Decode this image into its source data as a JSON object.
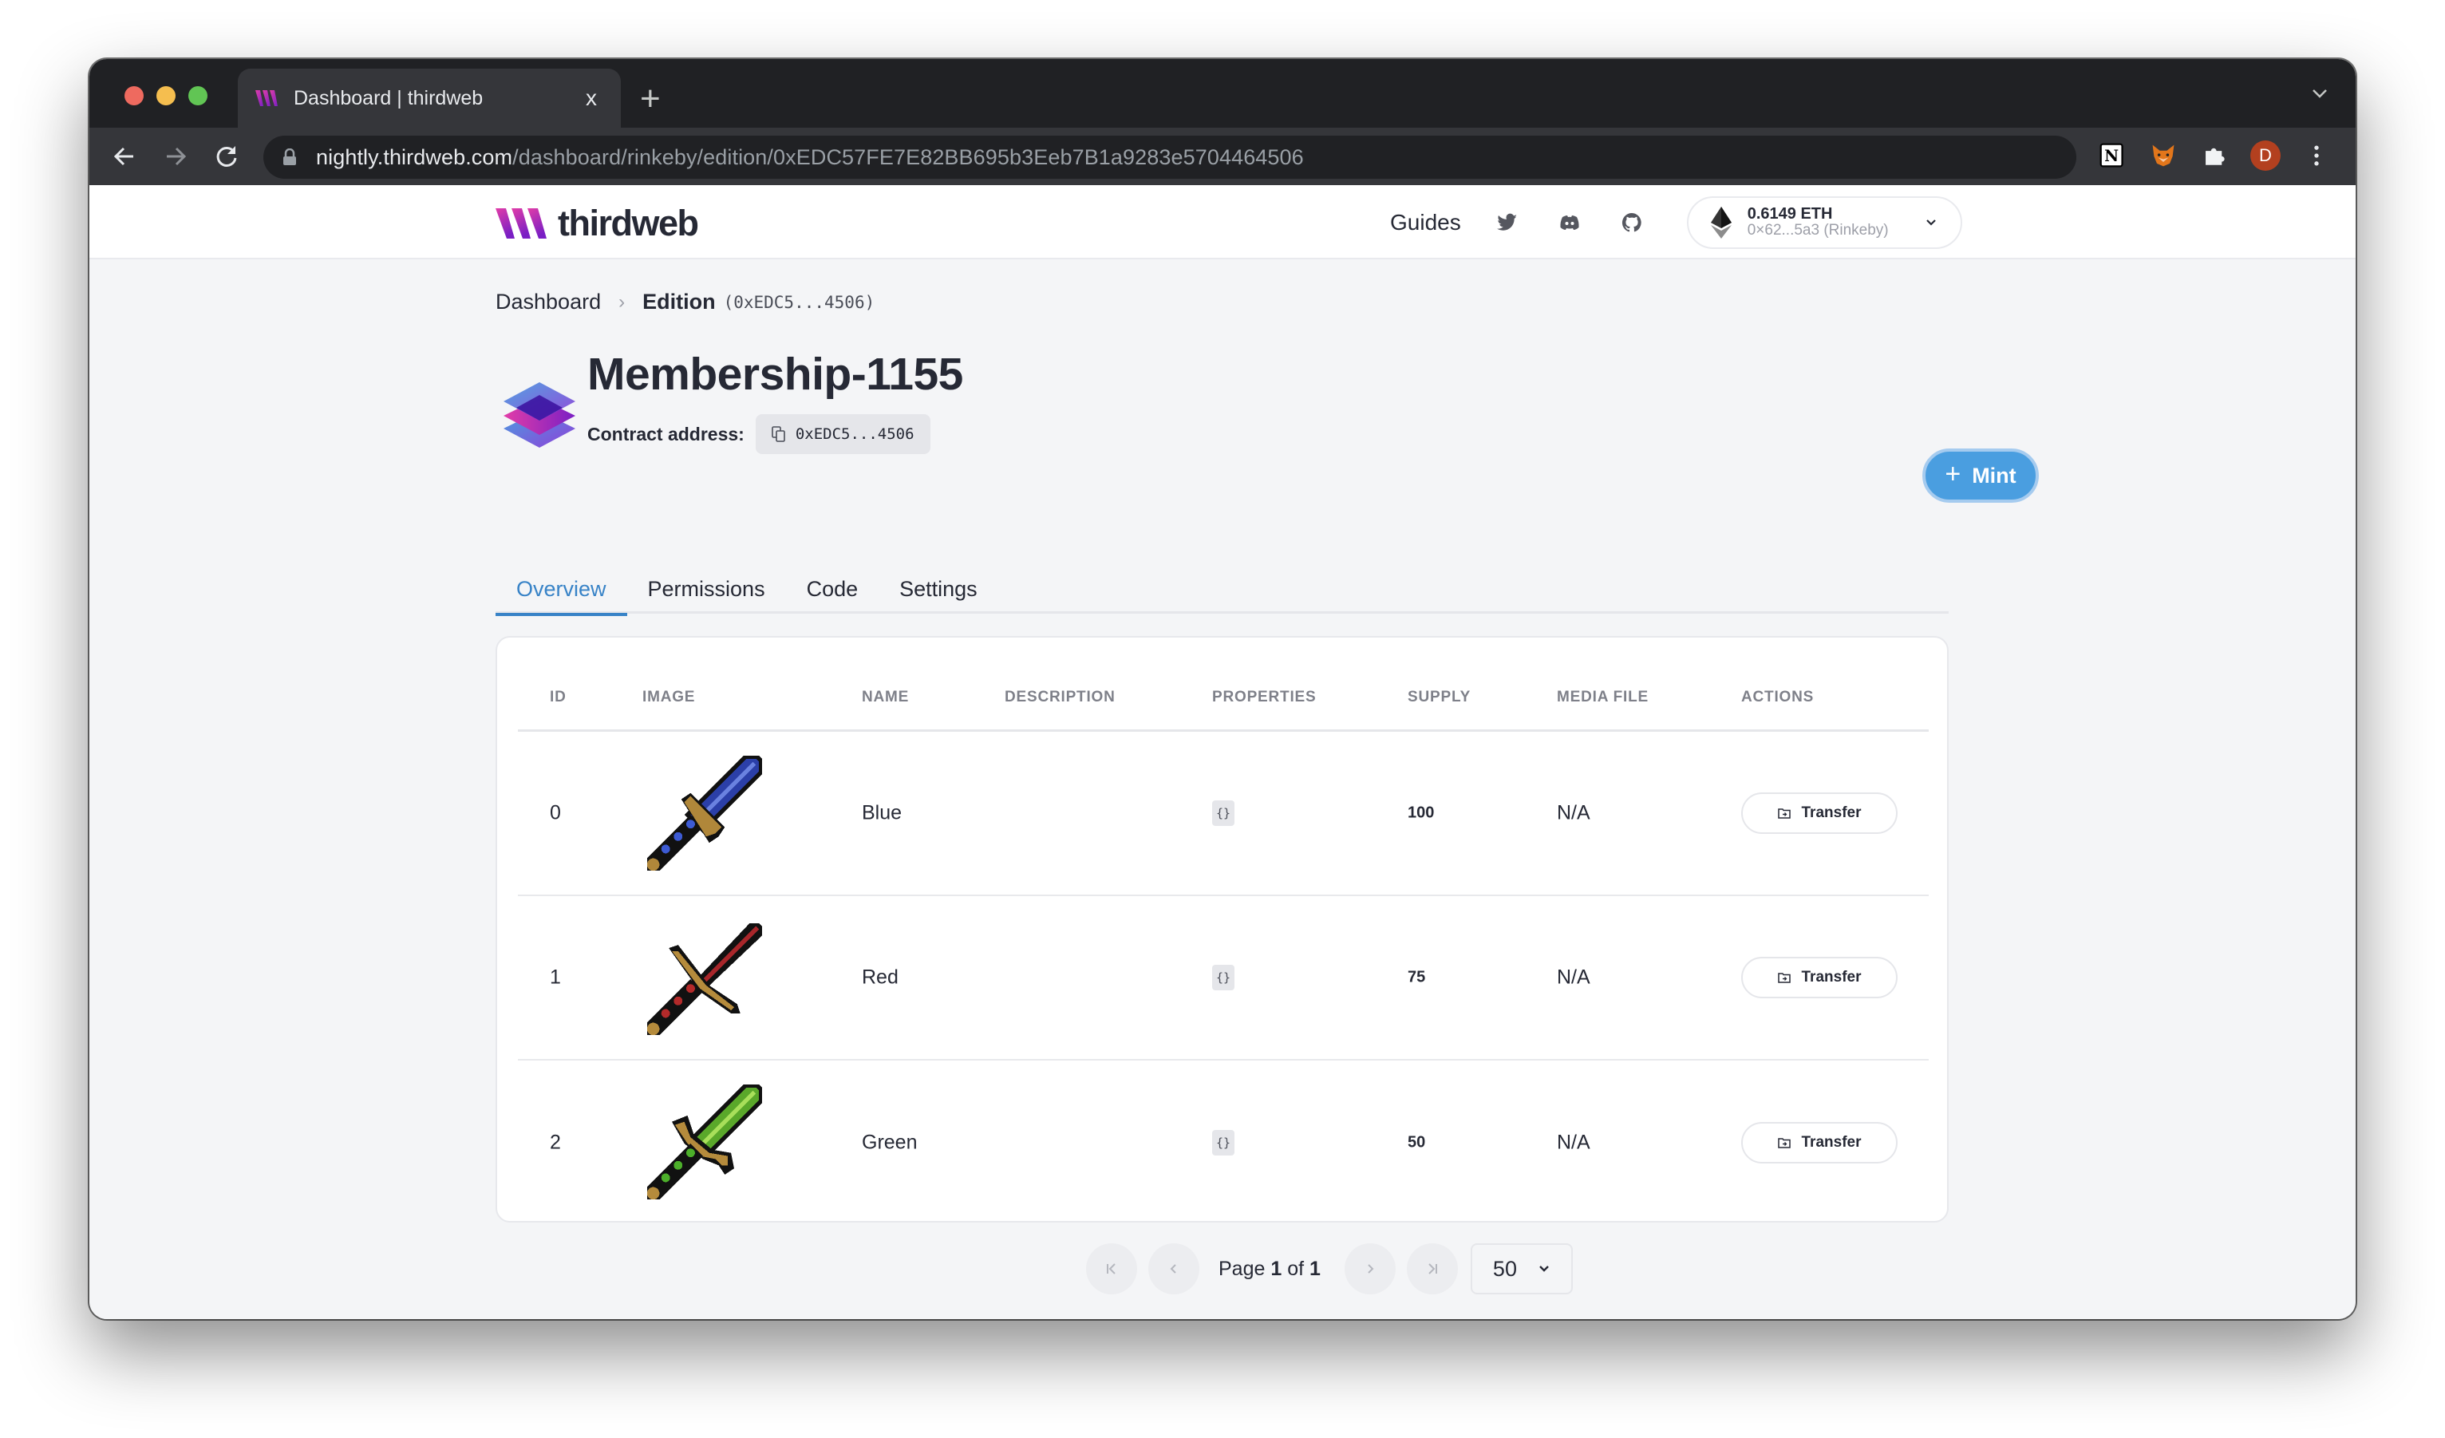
{
  "browser": {
    "tab_title": "Dashboard | thirdweb",
    "tab_close": "x",
    "new_tab": "+",
    "url_host": "nightly.thirdweb.com",
    "url_path": "/dashboard/rinkeby/edition/0xEDC57FE7E82BB695b3Eeb7B1a9283e5704464506",
    "profile_initial": "D",
    "colors": {
      "profile": "#b3401f",
      "chrome_dark": "#202124",
      "chrome_toolbar": "#35363a"
    }
  },
  "header": {
    "brand": "thirdweb",
    "nav_guides": "Guides",
    "social_icons": [
      "twitter-icon",
      "discord-icon",
      "github-icon"
    ],
    "wallet": {
      "balance": "0.6149 ETH",
      "address": "0×62...5a3 (Rinkeby)"
    }
  },
  "breadcrumb": {
    "root": "Dashboard",
    "separator": "›",
    "current": "Edition",
    "current_address": "(0xEDC5...4506)"
  },
  "contract": {
    "name": "Membership-1155",
    "address_label": "Contract address:",
    "address_short": "0xEDC5...4506",
    "mint_label": "Mint",
    "mint_plus": "+"
  },
  "tabs": [
    {
      "label": "Overview",
      "active": true
    },
    {
      "label": "Permissions",
      "active": false
    },
    {
      "label": "Code",
      "active": false
    },
    {
      "label": "Settings",
      "active": false
    }
  ],
  "table": {
    "columns": [
      "ID",
      "IMAGE",
      "NAME",
      "DESCRIPTION",
      "PROPERTIES",
      "SUPPLY",
      "MEDIA FILE",
      "ACTIONS"
    ],
    "rows": [
      {
        "id": "0",
        "image": "blue-sword",
        "name": "Blue",
        "description": "",
        "properties": "{}",
        "supply": "100",
        "media_file": "N/A",
        "action": "Transfer"
      },
      {
        "id": "1",
        "image": "red-sword",
        "name": "Red",
        "description": "",
        "properties": "{}",
        "supply": "75",
        "media_file": "N/A",
        "action": "Transfer"
      },
      {
        "id": "2",
        "image": "green-sword",
        "name": "Green",
        "description": "",
        "properties": "{}",
        "supply": "50",
        "media_file": "N/A",
        "action": "Transfer"
      }
    ]
  },
  "pagination": {
    "page_prefix": "Page",
    "current_page": "1",
    "of_label": "of",
    "total_pages": "1",
    "page_size": "50"
  },
  "colors": {
    "accent": "#3883c7",
    "mint_button": "#4a9ee0",
    "text_primary": "#262935",
    "page_bg": "#f4f5f7"
  }
}
